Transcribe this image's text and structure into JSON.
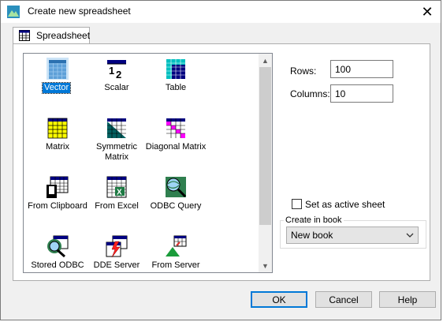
{
  "window": {
    "title": "Create new spreadsheet"
  },
  "tabs": [
    {
      "label": "Spreadsheet"
    }
  ],
  "list": {
    "items": [
      {
        "label": "Vector",
        "icon": "vector-icon",
        "selected": true
      },
      {
        "label": "Scalar",
        "icon": "scalar-icon"
      },
      {
        "label": "Table",
        "icon": "table-icon"
      },
      {
        "label": "Matrix",
        "icon": "matrix-icon"
      },
      {
        "label": "Symmetric Matrix",
        "icon": "symmetric-matrix-icon"
      },
      {
        "label": "Diagonal Matrix",
        "icon": "diagonal-matrix-icon"
      },
      {
        "label": "From Clipboard",
        "icon": "clipboard-icon"
      },
      {
        "label": "From Excel",
        "icon": "excel-icon"
      },
      {
        "label": "ODBC Query",
        "icon": "odbc-query-icon"
      },
      {
        "label": "Stored ODBC",
        "icon": "stored-odbc-icon"
      },
      {
        "label": "DDE Server",
        "icon": "dde-server-icon"
      },
      {
        "label": "From Server",
        "icon": "from-server-icon"
      }
    ]
  },
  "options": {
    "rows_label": "Rows:",
    "rows_value": "100",
    "columns_label": "Columns:",
    "columns_value": "10",
    "active_sheet_label": "Set as active sheet",
    "active_sheet_checked": false,
    "create_in_book_label": "Create in book",
    "book_value": "New book"
  },
  "buttons": {
    "ok": "OK",
    "cancel": "Cancel",
    "help": "Help"
  },
  "colors": {
    "accent": "#0078d7",
    "cyan": "#00c0c0",
    "navy": "#000080",
    "yellow": "#ffff00",
    "teal": "#006060",
    "magenta": "#ff00ff"
  }
}
